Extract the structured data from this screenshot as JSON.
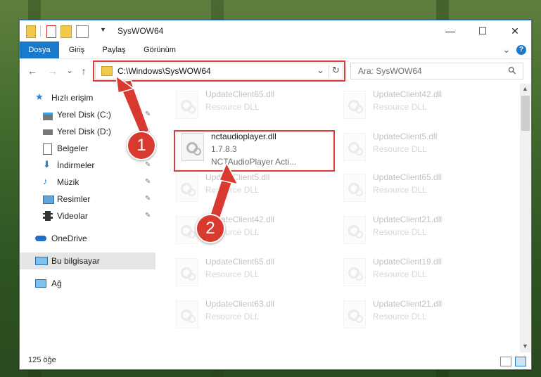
{
  "window": {
    "title": "SysWOW64",
    "minimize_glyph": "—",
    "maximize_glyph": "☐",
    "close_glyph": "✕"
  },
  "ribbon": {
    "tabs": [
      "Dosya",
      "Giriş",
      "Paylaş",
      "Görünüm"
    ],
    "collapse_glyph": "⌄",
    "help_glyph": "?"
  },
  "address": {
    "back_glyph": "←",
    "forward_glyph": "→",
    "recent_glyph": "⌄",
    "up_glyph": "↑",
    "path": "C:\\Windows\\SysWOW64",
    "dropdown_glyph": "⌄",
    "refresh_glyph": "↻"
  },
  "search": {
    "placeholder": "Ara: SysWOW64",
    "icon_glyph": "⚲"
  },
  "sidebar": {
    "items": [
      {
        "label": "Hızlı erişim",
        "icon": "star-icon"
      },
      {
        "label": "Yerel Disk (C:)",
        "icon": "drive-icon",
        "pinned": true
      },
      {
        "label": "Yerel Disk (D:)",
        "icon": "drive-icon",
        "pinned": true
      },
      {
        "label": "Belgeler",
        "icon": "documents-icon",
        "pinned": true
      },
      {
        "label": "İndirmeler",
        "icon": "downloads-icon",
        "pinned": true
      },
      {
        "label": "Müzik",
        "icon": "music-icon",
        "pinned": true
      },
      {
        "label": "Resimler",
        "icon": "pictures-icon",
        "pinned": true
      },
      {
        "label": "Videolar",
        "icon": "videos-icon",
        "pinned": true
      },
      {
        "label": "OneDrive",
        "icon": "onedrive-icon"
      },
      {
        "label": "Bu bilgisayar",
        "icon": "this-pc-icon",
        "selected": true
      },
      {
        "label": "Ağ",
        "icon": "network-icon"
      }
    ],
    "pin_glyph": "📌"
  },
  "files": {
    "column1": [
      {
        "name": "UpdateClient65.dll",
        "type": "Resource DLL"
      },
      {
        "name": "nctaudioplayer.dll",
        "version": "1.7.8.3",
        "desc": "NCTAudioPlayer Acti..."
      },
      {
        "name": "UpdateClient5.dll",
        "type": "Resource DLL"
      },
      {
        "name": "UpdateClient42.dll",
        "type": "Resource DLL"
      },
      {
        "name": "UpdateClient65.dll",
        "type": "Resource DLL"
      },
      {
        "name": "UpdateClient63.dll",
        "type": "Resource DLL"
      }
    ],
    "column2": [
      {
        "name": "UpdateClient42.dll",
        "type": "Resource DLL"
      },
      {
        "name": "UpdateClient5.dll",
        "type": "Resource DLL"
      },
      {
        "name": "UpdateClient65.dll",
        "type": "Resource DLL"
      },
      {
        "name": "UpdateClient21.dll",
        "type": "Resource DLL"
      },
      {
        "name": "UpdateClient19.dll",
        "type": "Resource DLL"
      },
      {
        "name": "UpdateClient21.dll",
        "type": "Resource DLL"
      }
    ]
  },
  "status": {
    "count": "125 öğe"
  },
  "annotations": {
    "step1": "1",
    "step2": "2",
    "color": "#d93a30"
  },
  "colors": {
    "accent": "#1979ca",
    "highlight": "#e03b3b"
  }
}
